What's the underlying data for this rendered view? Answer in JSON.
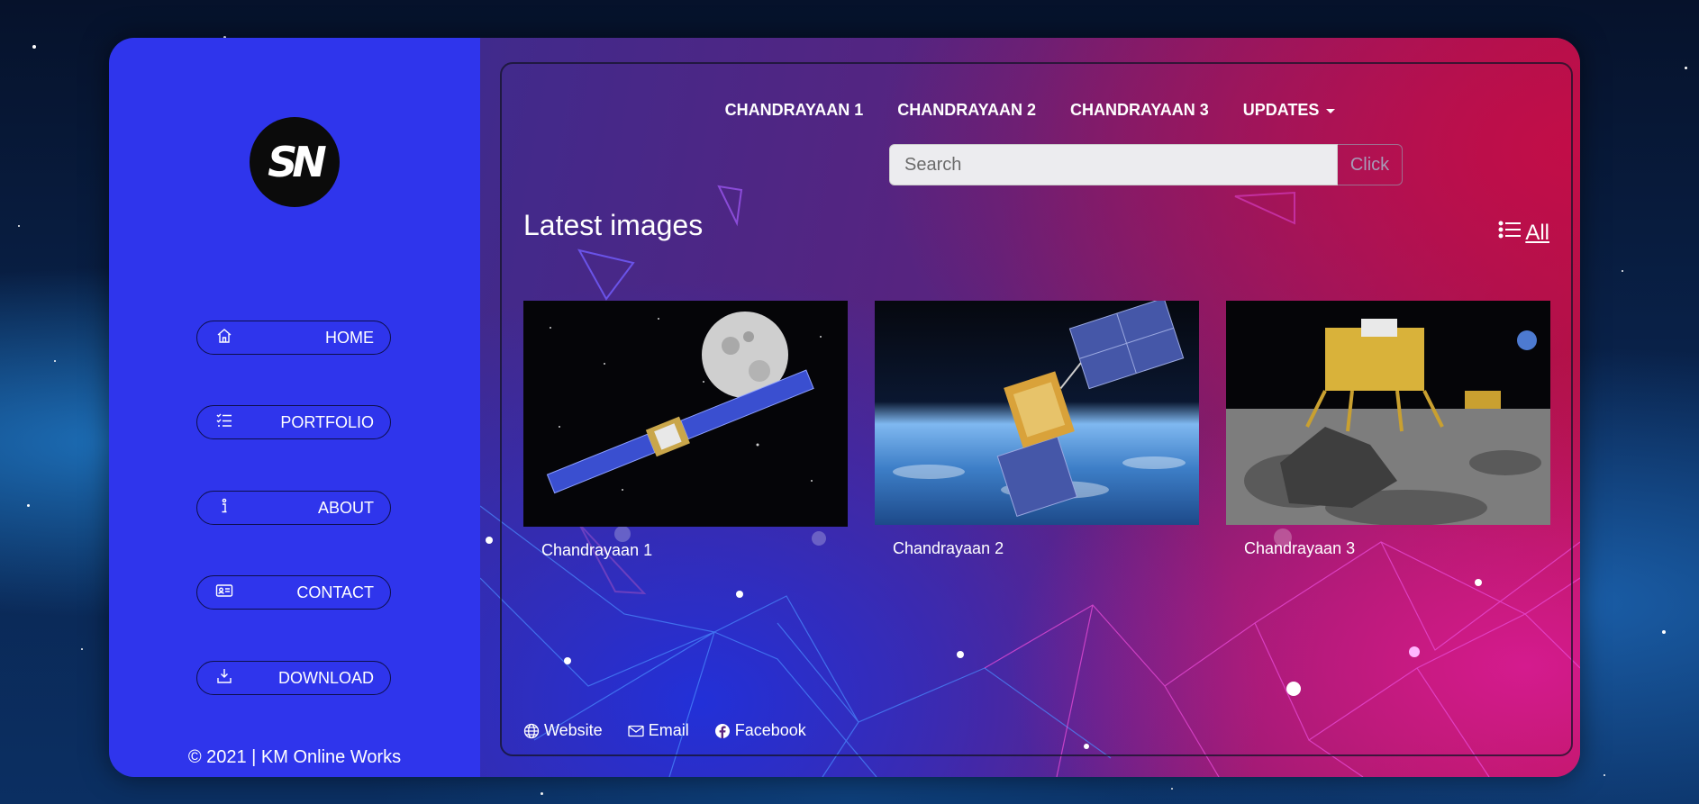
{
  "brand": {
    "logo_text": "SN"
  },
  "sidebar": {
    "items": [
      {
        "label": "HOME",
        "icon": "home-icon"
      },
      {
        "label": "PORTFOLIO",
        "icon": "list-check-icon"
      },
      {
        "label": "ABOUT",
        "icon": "info-icon"
      },
      {
        "label": "CONTACT",
        "icon": "contact-card-icon"
      },
      {
        "label": "DOWNLOAD",
        "icon": "download-icon"
      }
    ],
    "copyright": "© 2021 | KM Online Works"
  },
  "topnav": {
    "items": [
      "CHANDRAYAAN 1",
      "CHANDRAYAAN 2",
      "CHANDRAYAAN 3"
    ],
    "dropdown_label": "UPDATES"
  },
  "search": {
    "placeholder": "Search",
    "button_label": "Click"
  },
  "gallery": {
    "title": "Latest images",
    "all_label": "All",
    "cards": [
      {
        "caption": "Chandrayaan 1"
      },
      {
        "caption": "Chandrayaan 2"
      },
      {
        "caption": "Chandrayaan 3"
      }
    ]
  },
  "footer": {
    "links": [
      "Website",
      "Email",
      "Facebook"
    ]
  },
  "colors": {
    "sidebar_bg": "#2f35ec",
    "main_gradient_left": "#402a8c",
    "main_gradient_right": "#b0123e"
  }
}
